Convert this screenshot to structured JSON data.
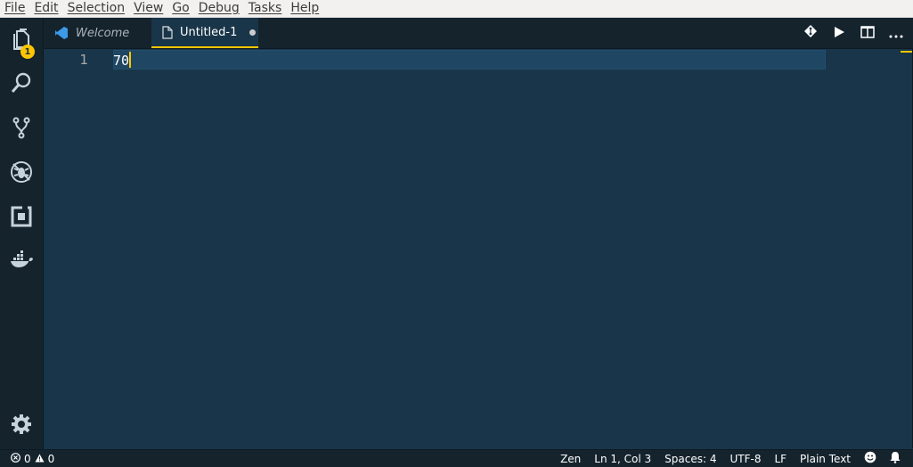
{
  "menubar": {
    "items": [
      "File",
      "Edit",
      "Selection",
      "View",
      "Go",
      "Debug",
      "Tasks",
      "Help"
    ]
  },
  "activitybar": {
    "explorer_badge": "1",
    "icons": [
      "files-icon",
      "search-icon",
      "source-control-icon",
      "debug-icon",
      "extensions-icon",
      "docker-icon",
      "settings-gear-icon"
    ]
  },
  "tabs": [
    {
      "label": "Welcome",
      "active": false
    },
    {
      "label": "Untitled-1",
      "active": true,
      "dirty": true
    }
  ],
  "editor": {
    "line_numbers": [
      "1"
    ],
    "lines": [
      "70"
    ]
  },
  "statusbar": {
    "errors": "0",
    "warnings": "0",
    "zen": "Zen",
    "position": "Ln 1, Col 3",
    "indent": "Spaces: 4",
    "encoding": "UTF-8",
    "eol": "LF",
    "language": "Plain Text"
  },
  "colors": {
    "background": "#193549",
    "accent": "#ffc600",
    "sidebar": "#15232d"
  }
}
